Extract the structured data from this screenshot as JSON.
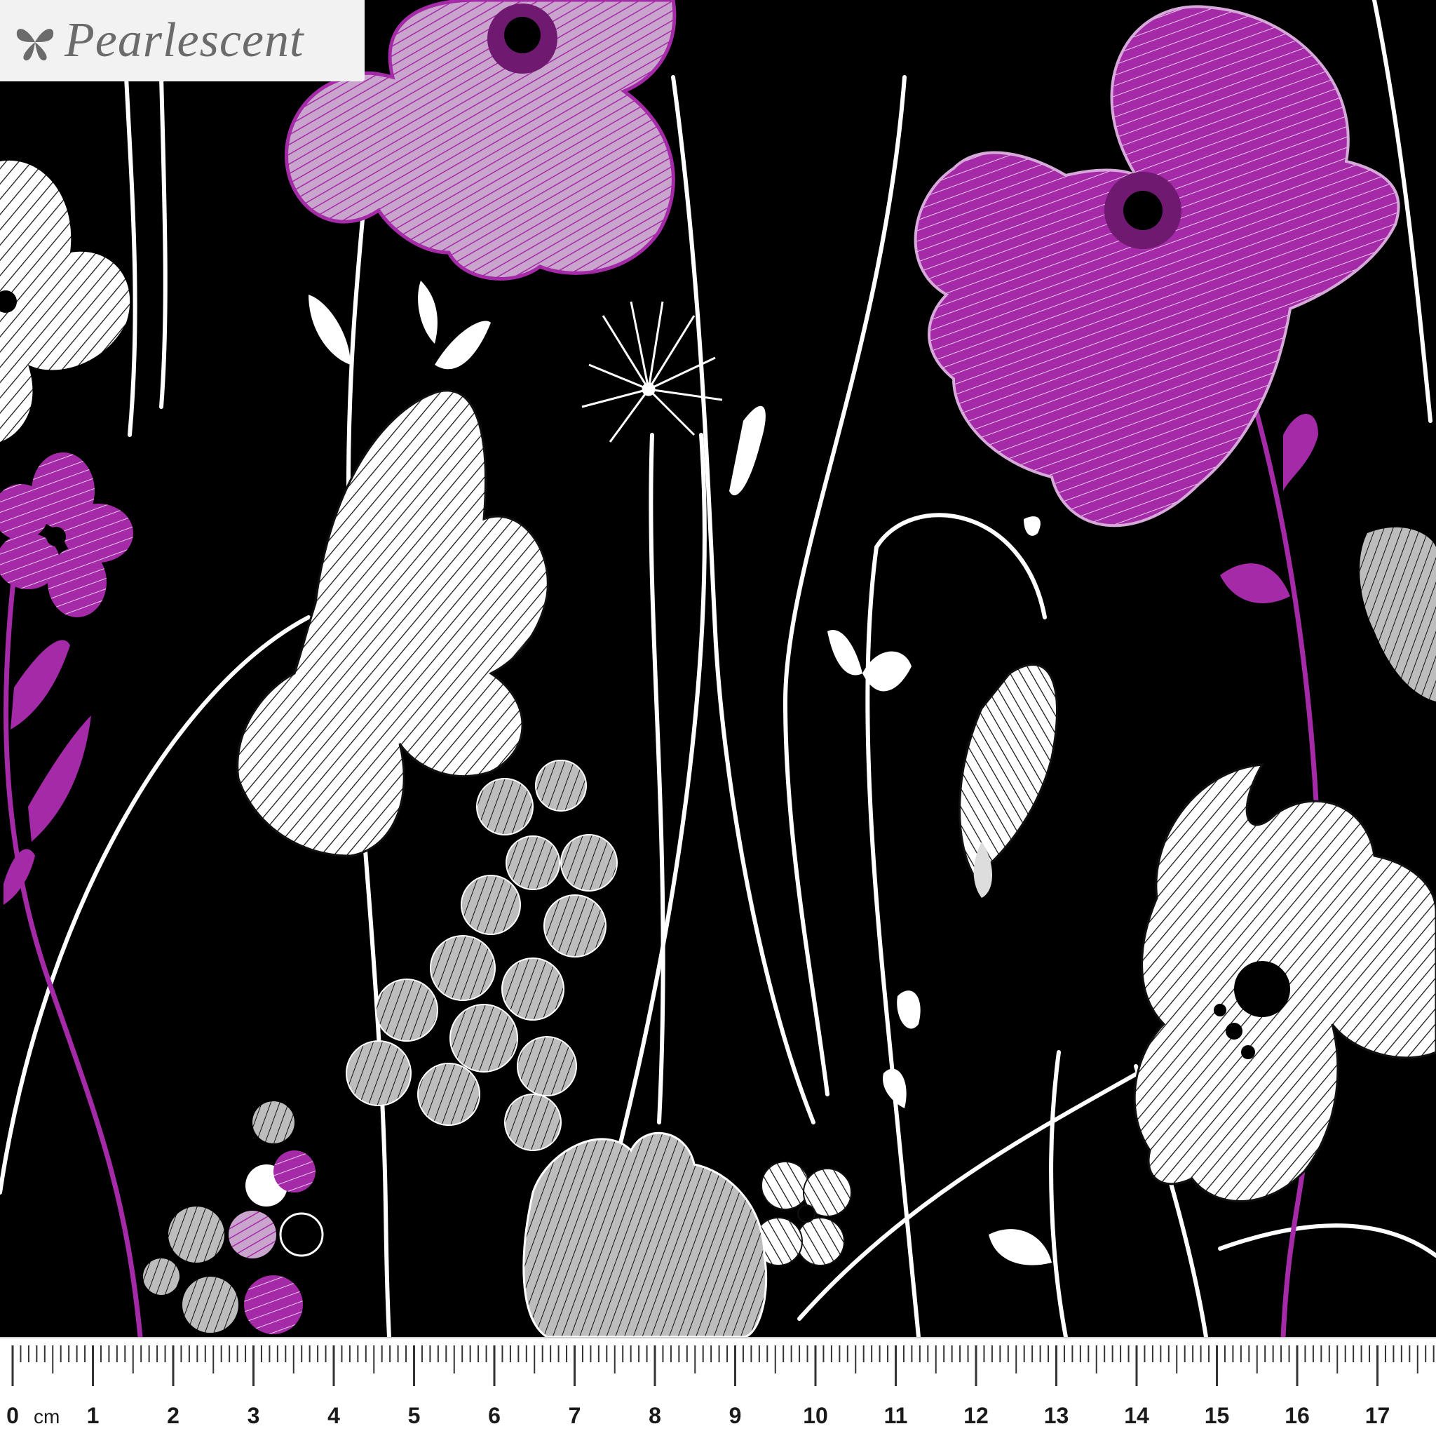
{
  "brand": {
    "name": "Pearlescent",
    "icon": "butterfly-icon"
  },
  "fabric": {
    "background_color": "#000000",
    "accent_color": "#a52aa8",
    "line_color": "#ffffff"
  },
  "ruler": {
    "unit": "cm",
    "labels": [
      "0",
      "1",
      "2",
      "3",
      "4",
      "5",
      "6",
      "7",
      "8",
      "9",
      "10",
      "11",
      "12",
      "13",
      "14",
      "15",
      "16",
      "17"
    ]
  }
}
